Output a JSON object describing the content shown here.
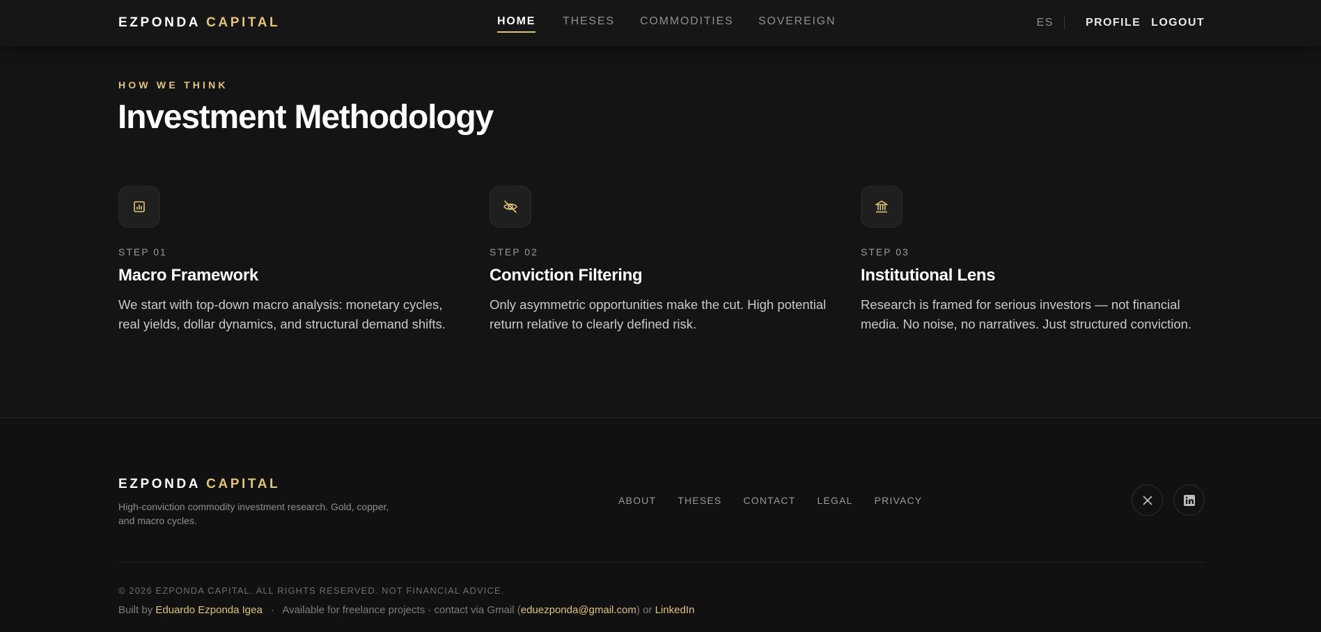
{
  "header": {
    "logo_primary": "EZPONDA",
    "logo_accent": "CAPITAL",
    "nav": [
      {
        "label": "HOME",
        "active": true
      },
      {
        "label": "THESES",
        "active": false
      },
      {
        "label": "COMMODITIES",
        "active": false
      },
      {
        "label": "SOVEREIGN",
        "active": false
      }
    ],
    "lang": "ES",
    "profile": "PROFILE",
    "logout": "LOGOUT"
  },
  "hero": {
    "eyebrow": "HOW WE THINK",
    "title": "Investment Methodology"
  },
  "steps": [
    {
      "icon": "bar-chart-icon",
      "number": "STEP 01",
      "title": "Macro Framework",
      "body": "We start with top-down macro analysis: monetary cycles, real yields, dollar dynamics, and structural demand shifts."
    },
    {
      "icon": "eye-off-icon",
      "number": "STEP 02",
      "title": "Conviction Filtering",
      "body": "Only asymmetric opportunities make the cut. High potential return relative to clearly defined risk."
    },
    {
      "icon": "bank-icon",
      "number": "STEP 03",
      "title": "Institutional Lens",
      "body": "Research is framed for serious investors — not financial media. No noise, no narratives. Just structured conviction."
    }
  ],
  "footer": {
    "logo_primary": "EZPONDA",
    "logo_accent": "CAPITAL",
    "tagline": "High-conviction commodity investment research. Gold, copper, and macro cycles.",
    "links": [
      "ABOUT",
      "THESES",
      "CONTACT",
      "LEGAL",
      "PRIVACY"
    ],
    "social": [
      "x-icon",
      "linkedin-icon"
    ],
    "copyright": "© 2026 EZPONDA CAPITAL. ALL RIGHTS RESERVED. NOT FINANCIAL ADVICE.",
    "credits": {
      "built_by": "Built by",
      "author": "Eduardo Ezponda Igea",
      "separator": "·",
      "available": "Available for freelance projects · contact via Gmail (",
      "email": "eduezponda@gmail.com",
      "or": ") or",
      "linkedin": "LinkedIn"
    }
  },
  "colors": {
    "accent": "#e2c47a",
    "background": "#141414",
    "footer_background": "#111111"
  }
}
